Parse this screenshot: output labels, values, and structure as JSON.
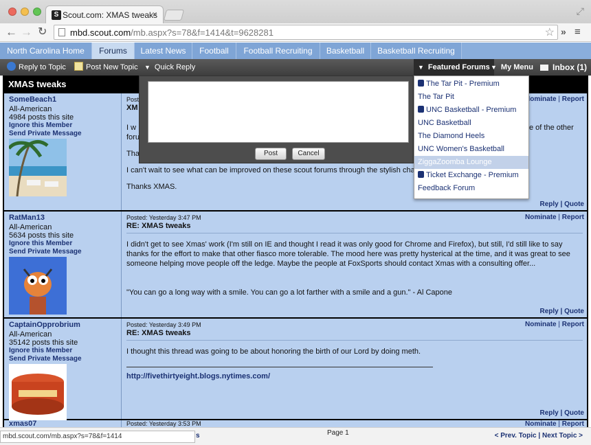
{
  "browser": {
    "tab_title": "Scout.com: XMAS tweaks",
    "favicon": "S",
    "url_host": "mbd.scout.com",
    "url_path": "/mb.aspx?s=78&f=1414&t=9628281",
    "status_url": "mbd.scout.com/mb.aspx?s=78&f=1414"
  },
  "nav": {
    "tabs": [
      {
        "label": "North Carolina Home"
      },
      {
        "label": "Forums"
      },
      {
        "label": "Latest News"
      },
      {
        "label": "Football"
      },
      {
        "label": "Football Recruiting"
      },
      {
        "label": "Basketball"
      },
      {
        "label": "Basketball Recruiting"
      }
    ]
  },
  "actions": {
    "reply_to_topic": "Reply to Topic",
    "post_new_topic": "Post New Topic",
    "quick_reply": "Quick Reply",
    "featured_forums": "Featured Forums",
    "my_menu": "My Menu",
    "inbox": "Inbox (1)"
  },
  "thread": {
    "title": "XMAS tweaks"
  },
  "quick_reply": {
    "post_label": "Post",
    "cancel_label": "Cancel"
  },
  "featured_menu": {
    "items": [
      {
        "label": "The Tar Pit - Premium",
        "premium": true
      },
      {
        "label": "The Tar Pit",
        "premium": false
      },
      {
        "label": "UNC Basketball - Premium",
        "premium": true
      },
      {
        "label": "UNC Basketball",
        "premium": false
      },
      {
        "label": "The Diamond Heels",
        "premium": false
      },
      {
        "label": "UNC Women's Basketball",
        "premium": false
      },
      {
        "label": "ZiggaZoomba Lounge",
        "premium": false,
        "highlighted": true
      },
      {
        "label": "Ticket Exchange - Premium",
        "premium": true
      },
      {
        "label": "Feedback Forum",
        "premium": false
      }
    ]
  },
  "labels": {
    "ignore": "Ignore this Member",
    "send_pm": "Send Private Message",
    "nominate": "Nominate",
    "report": "Report",
    "reply": "Reply",
    "quote": "Quote",
    "sep": "|"
  },
  "posts": [
    {
      "user": "SomeBeach1",
      "rank": "All-American",
      "count": "4984 posts this site",
      "time": "Posted: ",
      "subject": "XM",
      "body": [
        "I w",
        "foru",
        "Tha",
        "I can't wait to see what can be improved on these scout forums through the stylish cha",
        "Thanks XMAS."
      ],
      "body_right": "e of the other"
    },
    {
      "user": "RatMan13",
      "rank": "All-American",
      "count": "5634 posts this site",
      "time": "Posted: Yesterday 3:47 PM",
      "subject": "RE: XMAS tweaks",
      "body": [
        "I didn't get to see Xmas' work (I'm still on IE and thought I read it was only good for Chrome and Firefox), but still, I'd still like to say thanks for the effort to make that other fiasco more tolerable. The mood here was pretty hysterical at the time, and it was great to see someone helping move people off the ledge. Maybe the people at FoxSports should contact Xmas with a consulting offer...",
        "\"You can go a long way with a smile. You can go a lot farther with a smile and a gun.\" - Al Capone"
      ]
    },
    {
      "user": "CaptainOpprobrium",
      "rank": "All-American",
      "count": "35142 posts this site",
      "time": "Posted: Yesterday 3:49 PM",
      "subject": "RE: XMAS tweaks",
      "body": [
        "I thought this thread was going to be about honoring the birth of our Lord by doing meth.",
        "http://fivethirtyeight.blogs.nytimes.com/"
      ]
    },
    {
      "user": "xmas07",
      "time": "Posted: Yesterday 3:53 PM"
    }
  ],
  "footer": {
    "page": "Page 1",
    "prev": "< Prev. Topic",
    "next": "Next Topic >",
    "partial": "s"
  },
  "colors": {
    "accent": "#1b3173",
    "post_bg": "#b9d0ef",
    "nav_bg": "#7fa5d6"
  }
}
